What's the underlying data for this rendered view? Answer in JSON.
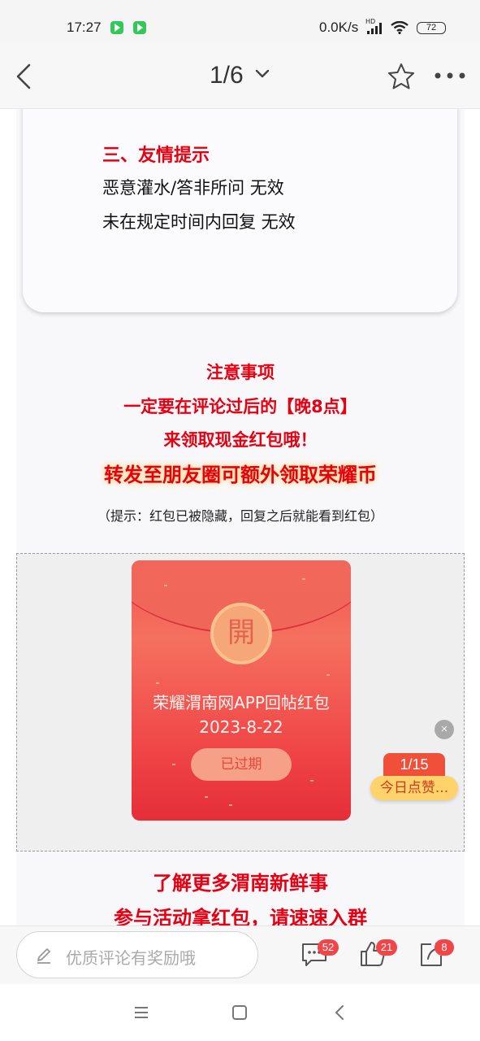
{
  "status_bar": {
    "time": "17:27",
    "network_speed": "0.0K/s",
    "hd_label": "HD",
    "battery": "72",
    "app_icons": [
      "video-app-icon",
      "video-app-icon"
    ]
  },
  "header": {
    "page_indicator": "1/6",
    "icons": [
      "back-arrow-icon",
      "chevron-down-icon",
      "star-icon",
      "more-icon"
    ]
  },
  "tips_card": {
    "title": "三、友情提示",
    "lines": [
      "恶意灌水/答非所问 无效",
      "未在规定时间内回复 无效"
    ]
  },
  "notice": {
    "title": "注意事项",
    "line1": "一定要在评论过后的【晚8点】",
    "line2": "来领取现金红包哦！",
    "line3": "转发至朋友圈可额外领取荣耀币",
    "hint": "（提示：红包已被隐藏，回复之后就能看到红包）"
  },
  "red_packet": {
    "seal": "開",
    "title": "荣耀渭南网APP回帖红包2023-8-22",
    "status_button": "已过期"
  },
  "floating_badge": {
    "close_symbol": "×",
    "count": "1/15",
    "label": "今日点赞..."
  },
  "bottom_text": {
    "line1": "了解更多渭南新鲜事",
    "line2": "参与活动拿红包，请速速入群"
  },
  "comment_bar": {
    "placeholder": "优质评论有奖励哦",
    "comments_count": "52",
    "likes_count": "21",
    "shares_count": "8"
  },
  "colors": {
    "accent_red": "#e60012",
    "badge_red": "#f2454a",
    "packet_red": "#f04848"
  }
}
